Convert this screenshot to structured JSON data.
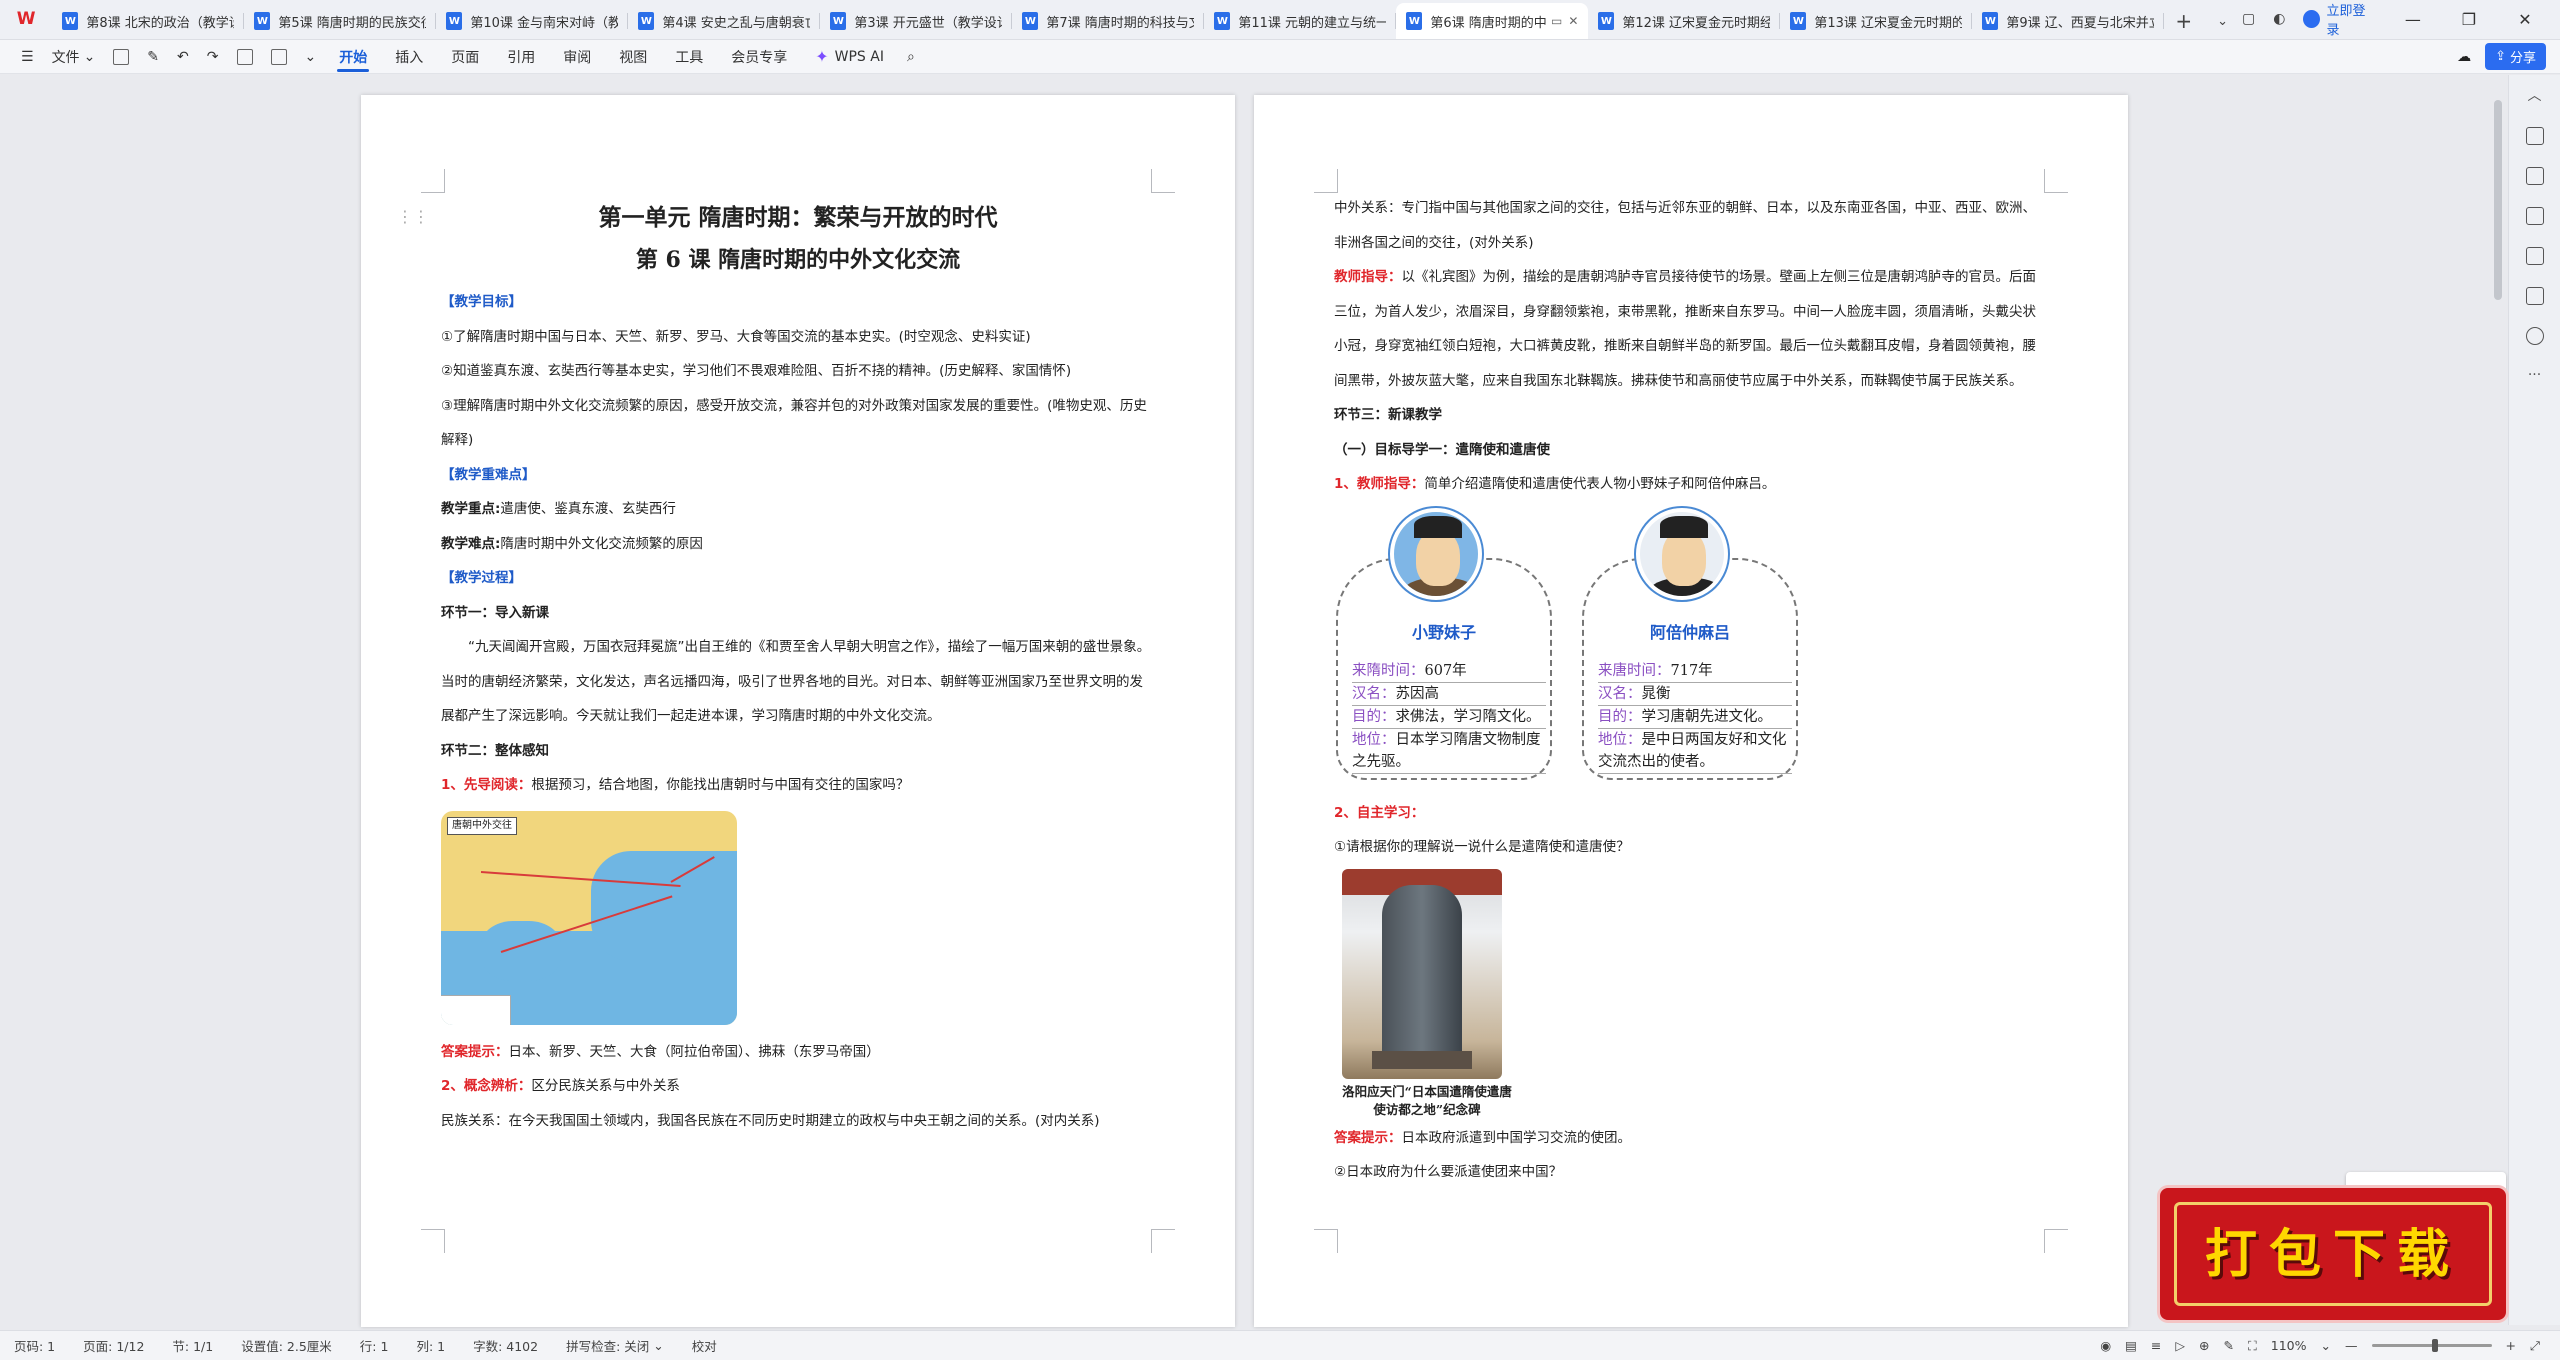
{
  "app": {
    "logo_text": "W",
    "tabs": [
      {
        "label": "第8课 北宋的政治（教学设计",
        "active": false
      },
      {
        "label": "第5课 隋唐时期的民族交往",
        "active": false
      },
      {
        "label": "第10课 金与南宋对峙（教学",
        "active": false
      },
      {
        "label": "第4课 安史之乱与唐朝衰亡",
        "active": false
      },
      {
        "label": "第3课 开元盛世（教学设计",
        "active": false
      },
      {
        "label": "第7课 隋唐时期的科技与文",
        "active": false
      },
      {
        "label": "第11课 元朝的建立与统一",
        "active": false
      },
      {
        "label": "第6课 隋唐时期的中",
        "active": true
      },
      {
        "label": "第12课 辽宋夏金元时期经济",
        "active": false
      },
      {
        "label": "第13课 辽宋夏金元时期的文",
        "active": false
      },
      {
        "label": "第9课 辽、西夏与北宋并立",
        "active": false
      }
    ],
    "login_label": "立即登录"
  },
  "toolbar": {
    "file_label": "文件",
    "menus": [
      "开始",
      "插入",
      "页面",
      "引用",
      "审阅",
      "视图",
      "工具",
      "会员专享"
    ],
    "active_menu": "开始",
    "wps_ai_label": "WPS AI",
    "share_label": "分享"
  },
  "left_page": {
    "unit_title": "第一单元  隋唐时期：繁荣与开放的时代",
    "lesson_title": "第 6 课    隋唐时期的中外文化交流",
    "goals_heading": "【教学目标】",
    "goal_1": "①了解隋唐时期中国与日本、天竺、新罗、罗马、大食等国交流的基本史实。(时空观念、史料实证)",
    "goal_2": "②知道鉴真东渡、玄奘西行等基本史实，学习他们不畏艰难险阻、百折不挠的精神。(历史解释、家国情怀)",
    "goal_3": "③理解隋唐时期中外文化交流频繁的原因，感受开放交流，兼容并包的对外政策对国家发展的重要性。(唯物史观、历史解释)",
    "key_heading": "【教学重难点】",
    "key_label": "教学重点:",
    "key_text": "遣唐使、鉴真东渡、玄奘西行",
    "difficulty_label": "教学难点:",
    "difficulty_text": "隋唐时期中外文化交流频繁的原因",
    "process_heading": "【教学过程】",
    "step1_title": "环节一：导入新课",
    "intro_paragraph": "“九天阊阖开宫殿，万国衣冠拜冕旒”出自王维的《和贾至舍人早朝大明宫之作》，描绘了一幅万国来朝的盛世景象。当时的唐朝经济繁荣，文化发达，声名远播四海，吸引了世界各地的目光。对日本、朝鲜等亚洲国家乃至世界文明的发展都产生了深远影响。今天就让我们一起走进本课，学习隋唐时期的中外文化交流。",
    "step2_title": "环节二：整体感知",
    "prereading_label": "1、先导阅读：",
    "prereading_text": "根据预习，结合地图，你能找出唐朝时与中国有交往的国家吗？",
    "map_title": "唐朝中外交往",
    "answer_label": "答案提示：",
    "answer_text": "日本、新罗、天竺、大食（阿拉伯帝国）、拂菻（东罗马帝国）",
    "concept_label": "2、概念辨析：",
    "concept_text": "区分民族关系与中外关系",
    "ethnic_text": "民族关系：在今天我国国土领域内，我国各民族在不同历史时期建立的政权与中央王朝之间的关系。(对内关系)"
  },
  "right_page": {
    "foreign_text": "中外关系：专门指中国与其他国家之间的交往，包括与近邻东亚的朝鲜、日本，以及东南亚各国，中亚、西亚、欧洲、非洲各国之间的交往，(对外关系)",
    "teacher_label": "教师指导：",
    "teacher_text": "以《礼宾图》为例，描绘的是唐朝鸿胪寺官员接待使节的场景。壁画上左侧三位是唐朝鸿胪寺的官员。后面三位，为首人发少，浓眉深目，身穿翻领紫袍，束带黑靴，推断来自东罗马。中间一人脸庞丰圆，须眉清晰，头戴尖状小冠，身穿宽袖红领白短袍，大口裤黄皮靴，推断来自朝鲜半岛的新罗国。最后一位头戴翻耳皮帽，身着圆领黄袍，腰间黑带，外披灰蓝大氅，应来自我国东北靺鞨族。拂菻使节和高丽使节应属于中外关系，而靺鞨使节属于民族关系。",
    "step3_title": "环节三：新课教学",
    "target1_title": "（一）目标导学一：遣隋使和遣唐使",
    "teacher2_label": "1、教师指导：",
    "teacher2_text": "简单介绍遣隋使和遣唐使代表人物小野妹子和阿倍仲麻吕。",
    "envoys": [
      {
        "name": "小野妹子",
        "time_key": "来隋时间：",
        "time_val": "607年",
        "han_key": "汉名：",
        "han_val": "苏因高",
        "goal_key": "目的：",
        "goal_val": "求佛法，学习隋文化。",
        "status_key": "地位：",
        "status_val": "日本学习隋唐文物制度之先驱。"
      },
      {
        "name": "阿倍仲麻吕",
        "time_key": "来唐时间：",
        "time_val": "717年",
        "han_key": "汉名：",
        "han_val": "晁衡",
        "goal_key": "目的：",
        "goal_val": "学习唐朝先进文化。",
        "status_key": "地位：",
        "status_val": "是中日两国友好和文化交流杰出的使者。"
      }
    ],
    "self_label": "2、自主学习：",
    "q1": "①请根据你的理解说一说什么是遣隋使和遣唐使？",
    "stele_caption": "洛阳应天门“日本国遣隋使遣唐使访都之地”纪念碑",
    "answer2_label": "答案提示：",
    "answer2_text": "日本政府派遣到中国学习交流的使团。",
    "q2": "②日本政府为什么要派遣使团来中国？"
  },
  "badge": {
    "text": "打包下载"
  },
  "status": {
    "page_code": "页码: 1",
    "page": "页面: 1/12",
    "section": "节: 1/1",
    "setting": "设置值: 2.5厘米",
    "row": "行: 1",
    "col": "列: 1",
    "words": "字数: 4102",
    "spell": "拼写检查: 关闭",
    "proof": "校对",
    "zoom": "110%"
  },
  "colors": {
    "accent": "#1b5fd9",
    "section_blue": "#1f5bc8",
    "label_red": "#e0262b",
    "badge_red": "#c9161c",
    "badge_gold": "#ffd700"
  }
}
